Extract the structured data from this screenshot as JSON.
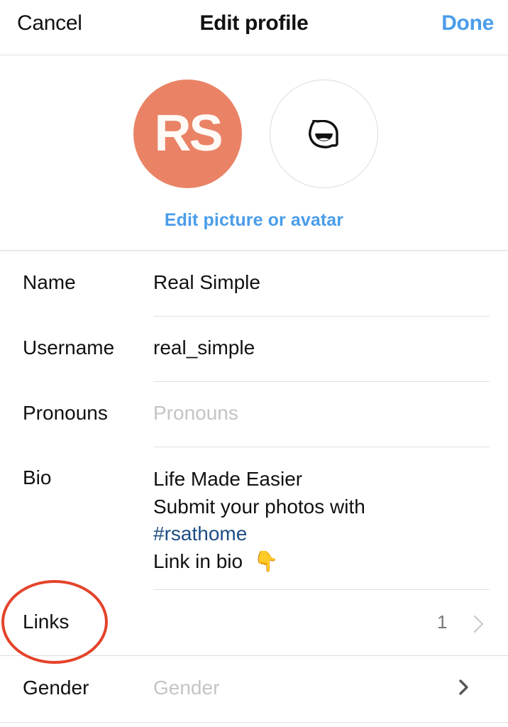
{
  "nav": {
    "cancel_label": "Cancel",
    "title": "Edit profile",
    "done_label": "Done"
  },
  "avatar": {
    "initials": "RS",
    "initials_bg_color": "#ea8366",
    "avatar_icon": "avatar-face-icon",
    "edit_link": "Edit picture or avatar"
  },
  "fields": {
    "name": {
      "label": "Name",
      "value": "Real Simple"
    },
    "username": {
      "label": "Username",
      "value": "real_simple"
    },
    "pronouns": {
      "label": "Pronouns",
      "placeholder": "Pronouns"
    },
    "bio": {
      "label": "Bio",
      "lines": [
        "Life Made Easier",
        "Submit your photos with",
        "#rsathome",
        "Link in bio"
      ],
      "emoji": "👇",
      "hashtag_color": "#1f4d82"
    },
    "links": {
      "label": "Links",
      "count": "1",
      "chevron": "chevron-right-icon"
    },
    "gender": {
      "label": "Gender",
      "placeholder": "Gender",
      "chevron": "chevron-right-icon"
    }
  },
  "colors": {
    "accent": "#4a9de9",
    "annotation": "#e4432a"
  }
}
